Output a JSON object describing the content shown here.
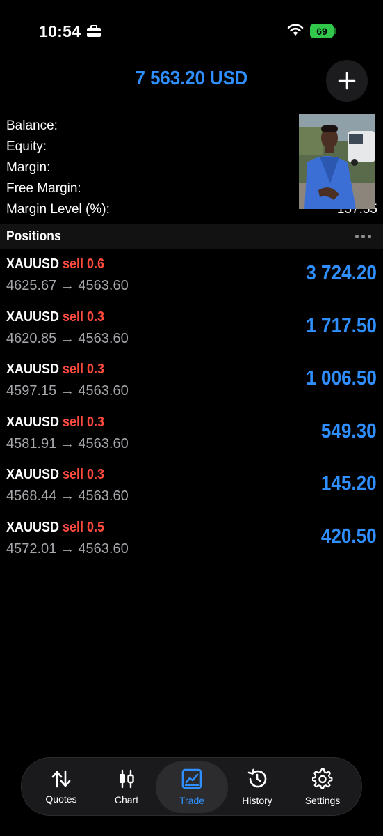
{
  "status_bar": {
    "time": "10:54",
    "battery": "69"
  },
  "header": {
    "total": "7 563.20 USD"
  },
  "summary": [
    {
      "label": "Balance:",
      "value": ""
    },
    {
      "label": "Equity:",
      "value": ""
    },
    {
      "label": "Margin:",
      "value": ""
    },
    {
      "label": "Free Margin:",
      "value": ""
    },
    {
      "label": "Margin Level (%):",
      "value": "157.55"
    }
  ],
  "positions_section": {
    "title": "Positions"
  },
  "positions": [
    {
      "symbol": "XAUUSD",
      "side": "sell 0.6",
      "prices": "4625.67 → 4563.60",
      "profit": "3 724.20"
    },
    {
      "symbol": "XAUUSD",
      "side": "sell 0.3",
      "prices": "4620.85 → 4563.60",
      "profit": "1 717.50"
    },
    {
      "symbol": "XAUUSD",
      "side": "sell 0.3",
      "prices": "4597.15 → 4563.60",
      "profit": "1 006.50"
    },
    {
      "symbol": "XAUUSD",
      "side": "sell 0.3",
      "prices": "4581.91 → 4563.60",
      "profit": "549.30"
    },
    {
      "symbol": "XAUUSD",
      "side": "sell 0.3",
      "prices": "4568.44 → 4563.60",
      "profit": "145.20"
    },
    {
      "symbol": "XAUUSD",
      "side": "sell 0.5",
      "prices": "4572.01 → 4563.60",
      "profit": "420.50"
    }
  ],
  "tabbar": {
    "quotes": "Quotes",
    "chart": "Chart",
    "trade": "Trade",
    "history": "History",
    "settings": "Settings"
  },
  "colors": {
    "accent": "#2f8fff",
    "sell": "#ff4a3d",
    "battery": "#30c74b"
  }
}
